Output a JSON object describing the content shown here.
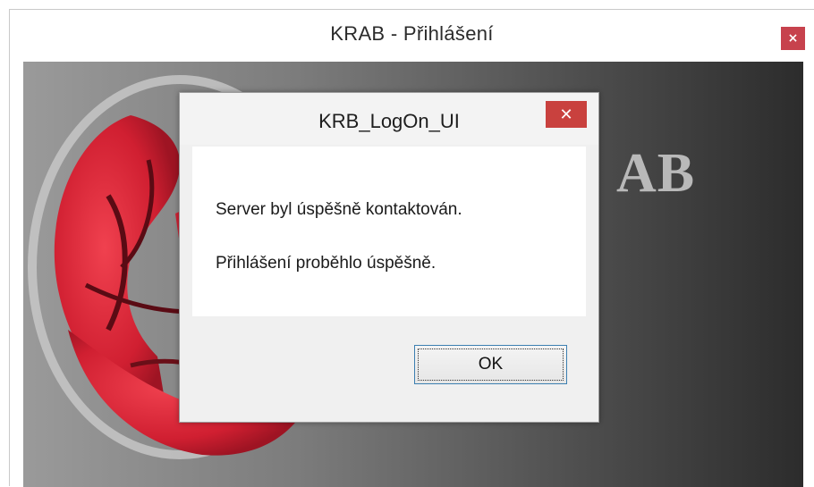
{
  "main_window": {
    "title": "KRAB - Přihlášení",
    "close_glyph": "×",
    "logo_text": "AB",
    "accent_color": "#c7424d"
  },
  "dialog": {
    "title": "KRB_LogOn_UI",
    "close_glyph": "✕",
    "messages": [
      "Server byl úspěšně kontaktován.",
      "Přihlášení proběhlo úspěšně."
    ],
    "ok_label": "OK",
    "close_color": "#c9413e",
    "focus_color": "#3c7fb1"
  }
}
